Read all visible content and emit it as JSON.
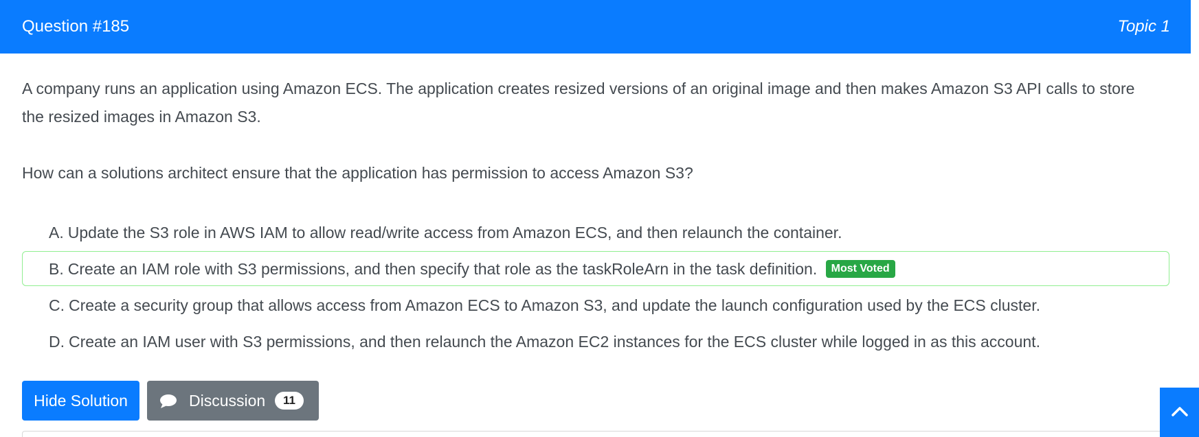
{
  "header": {
    "question_number": "Question #185",
    "topic": "Topic 1"
  },
  "question": {
    "text": "A company runs an application using Amazon ECS. The application creates resized versions of an original image and then makes Amazon S3 API calls to store the resized images in Amazon S3.",
    "ask": "How can a solutions architect ensure that the application has permission to access Amazon S3?"
  },
  "choices": [
    {
      "letter": "A.",
      "text": "Update the S3 role in AWS IAM to allow read/write access from Amazon ECS, and then relaunch the container."
    },
    {
      "letter": "B.",
      "text": "Create an IAM role with S3 permissions, and then specify that role as the taskRoleArn in the task definition.",
      "badge": "Most Voted"
    },
    {
      "letter": "C.",
      "text": "Create a security group that allows access from Amazon ECS to Amazon S3, and update the launch configuration used by the ECS cluster."
    },
    {
      "letter": "D.",
      "text": "Create an IAM user with S3 permissions, and then relaunch the Amazon EC2 instances for the ECS cluster while logged in as this account."
    }
  ],
  "actions": {
    "hide_solution_label": "Hide Solution",
    "discussion_label": "Discussion",
    "discussion_count": "11"
  },
  "icons": {
    "discussion": "chat-bubble-icon",
    "scroll_top": "chevron-up-icon"
  },
  "colors": {
    "primary": "#0a7cff",
    "secondary": "#6c757d",
    "success": "#28a745",
    "voted_border": "#90ee90"
  }
}
